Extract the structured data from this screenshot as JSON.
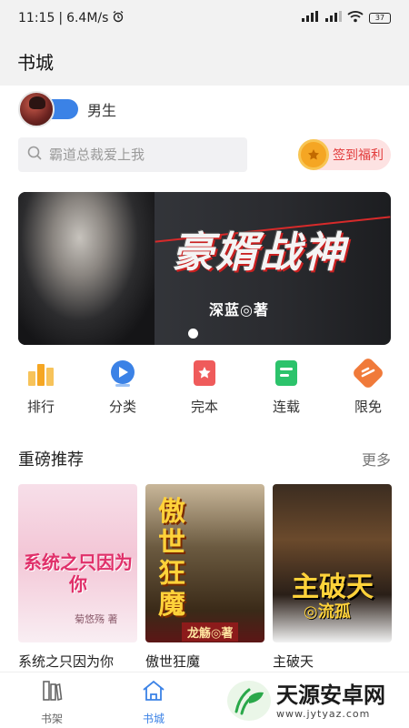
{
  "status_bar": {
    "time": "11:15",
    "speed": "6.4M/s",
    "battery": "37"
  },
  "app_bar": {
    "title": "书城"
  },
  "gender": {
    "label": "男生"
  },
  "search": {
    "placeholder": "霸道总裁爱上我"
  },
  "signin": {
    "label": "签到福利"
  },
  "banner": {
    "title": "豪婿战神",
    "author": "深蓝◎著",
    "pages": 1,
    "active_page": 1
  },
  "categories": [
    {
      "label": "排行",
      "icon": "rank-icon",
      "color": "#f5a623"
    },
    {
      "label": "分类",
      "icon": "category-icon",
      "color": "#3b82e6"
    },
    {
      "label": "完本",
      "icon": "finished-icon",
      "color": "#ef5b5b"
    },
    {
      "label": "连载",
      "icon": "serial-icon",
      "color": "#2cc36b"
    },
    {
      "label": "限免",
      "icon": "free-icon",
      "color": "#f07a3a"
    }
  ],
  "featured": {
    "title": "重磅推荐",
    "more_label": "更多",
    "books": [
      {
        "name": "系统之只因为你",
        "cover_title": "系统之只因为你",
        "cover_author": "菊悠殇 著"
      },
      {
        "name": "傲世狂魔",
        "cover_title": "傲世狂魔",
        "cover_author": "龙觞◎著"
      },
      {
        "name": "主破天",
        "cover_title": "主破天",
        "cover_author": "◎流孤"
      }
    ]
  },
  "tabbar": {
    "tabs": [
      {
        "label": "书架",
        "icon": "bookshelf-icon",
        "active": false
      },
      {
        "label": "书城",
        "icon": "bookstore-icon",
        "active": true
      }
    ],
    "active_color": "#3b82e6",
    "inactive_color": "#666666"
  },
  "watermark": {
    "brand": "天源安卓网",
    "url": "www.jytyaz.com"
  }
}
